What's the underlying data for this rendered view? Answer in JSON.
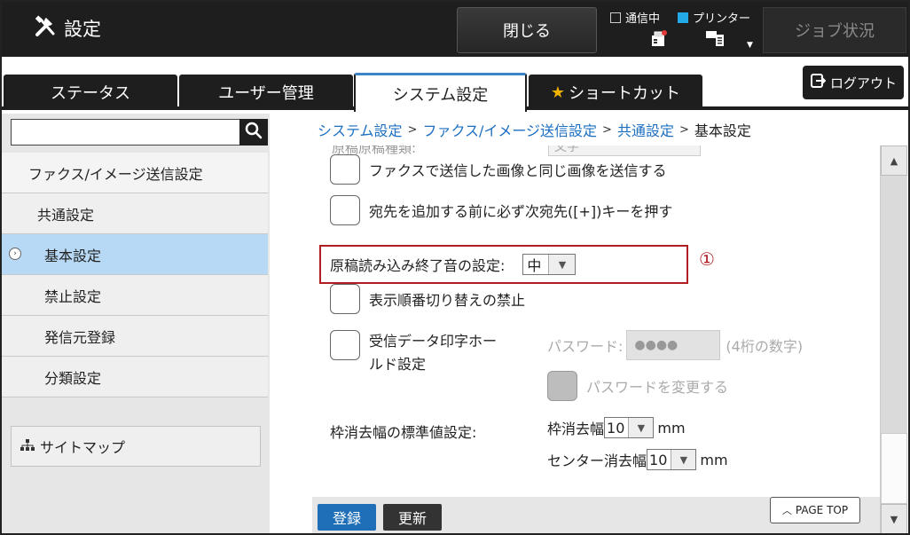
{
  "header": {
    "title": "設定",
    "close_label": "閉じる",
    "status_comm": "通信中",
    "status_printer": "プリンター",
    "job_status_label": "ジョブ状況"
  },
  "tabs": [
    {
      "label": "ステータス"
    },
    {
      "label": "ユーザー管理"
    },
    {
      "label": "システム設定"
    },
    {
      "label": "ショートカット"
    }
  ],
  "logout_label": "ログアウト",
  "sidebar": {
    "search_value": "",
    "items": [
      {
        "label": "ファクス/イメージ送信設定"
      },
      {
        "label": "共通設定"
      },
      {
        "label": "基本設定"
      },
      {
        "label": "禁止設定"
      },
      {
        "label": "発信元登録"
      },
      {
        "label": "分類設定"
      }
    ],
    "sitemap_label": "サイトマップ"
  },
  "breadcrumb": {
    "items": [
      "システム設定",
      "ファクス/イメージ送信設定",
      "共通設定",
      "基本設定"
    ],
    "separator": ">"
  },
  "settings": {
    "cutoff_text": "原稿原稿種類:",
    "cutoff_value": "文字",
    "fax_same_image": "ファクスで送信した画像と同じ画像を送信する",
    "next_dest_key": "宛先を追加する前に必ず次宛先([+])キーを押す",
    "scan_end_sound_label": "原稿読み込み終了音の設定:",
    "scan_end_sound_value": "中",
    "callout_marker": "①",
    "disable_order_switch": "表示順番切り替えの禁止",
    "hold_line1": "受信データ印字ホー",
    "hold_line2": "ルド設定",
    "password_label": "パスワード:",
    "password_value": "●●●●",
    "password_hint": "(4桁の数字)",
    "change_password": "パスワードを変更する",
    "erase_label": "枠消去幅の標準値設定:",
    "frame_erase_label": "枠消去幅",
    "frame_erase_value": "10",
    "center_erase_label": "センター消去幅",
    "center_erase_value": "10",
    "unit": "mm"
  },
  "footer": {
    "register_label": "登録",
    "update_label": "更新",
    "page_top_label": "PAGE TOP"
  },
  "colors": {
    "accent": "#1f6fb8",
    "link": "#1b6ec2",
    "highlight": "#b01e23",
    "nav_active": "#b8d9f5"
  }
}
